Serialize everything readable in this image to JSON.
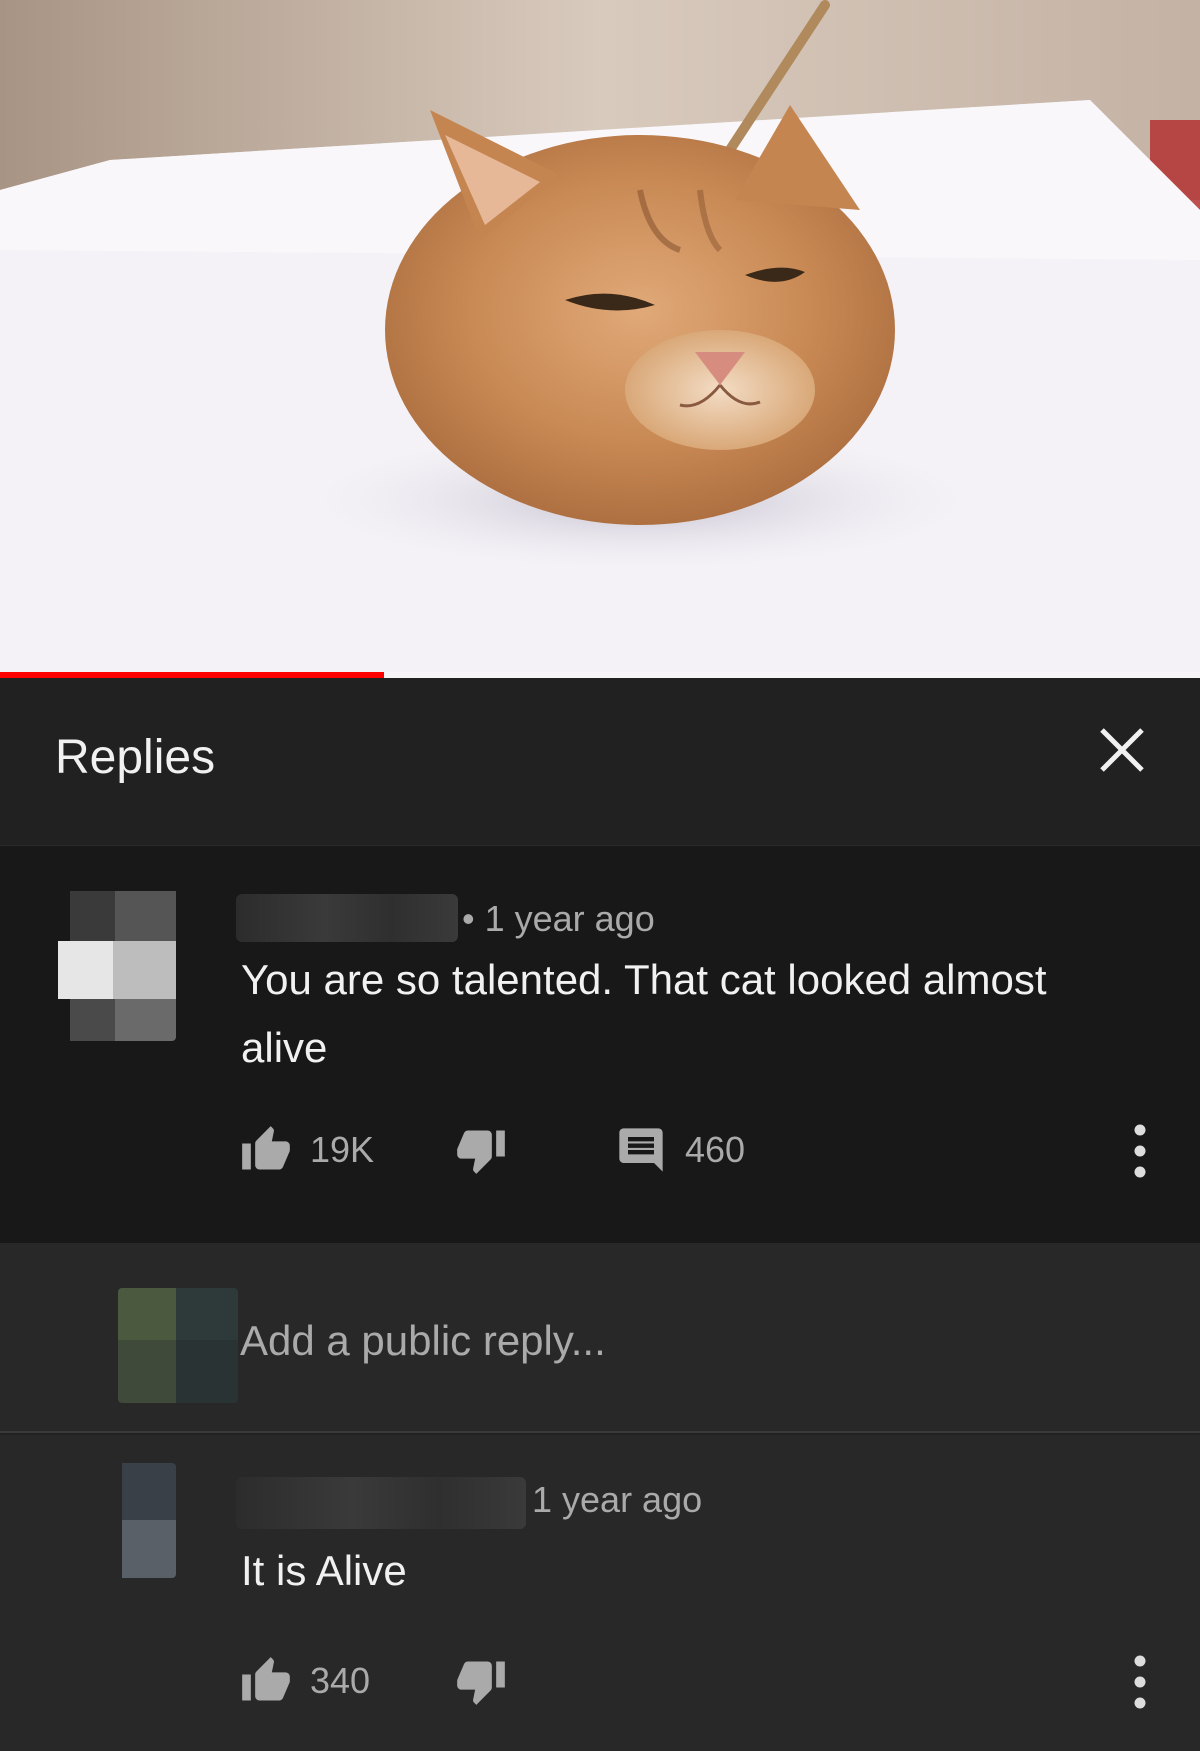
{
  "video": {
    "progress_fraction": 0.32,
    "progress_color": "#ff0000",
    "thumbnail_subject": "cat-head-on-white-table"
  },
  "header": {
    "title": "Replies",
    "close_icon": "close-icon"
  },
  "top_comment": {
    "time": "• 1 year ago",
    "text_line1": "You are so talented. That cat looked almost",
    "text_line2": "alive",
    "likes": "19K",
    "reply_count": "460",
    "icons": [
      "thumbs-up-icon",
      "thumbs-down-icon",
      "comment-icon",
      "more-vert-icon"
    ]
  },
  "add_reply": {
    "placeholder": "Add a public reply..."
  },
  "reply": {
    "time": "1 year ago",
    "text": "It is Alive",
    "likes": "340",
    "icons": [
      "thumbs-up-icon",
      "thumbs-down-icon",
      "more-vert-icon"
    ]
  },
  "colors": {
    "background": "#212121",
    "top_comment_bg": "#181818",
    "reply_bg": "#282828",
    "text_primary": "#f1f1f1",
    "text_secondary": "#aaaaaa",
    "accent": "#ff0000"
  }
}
